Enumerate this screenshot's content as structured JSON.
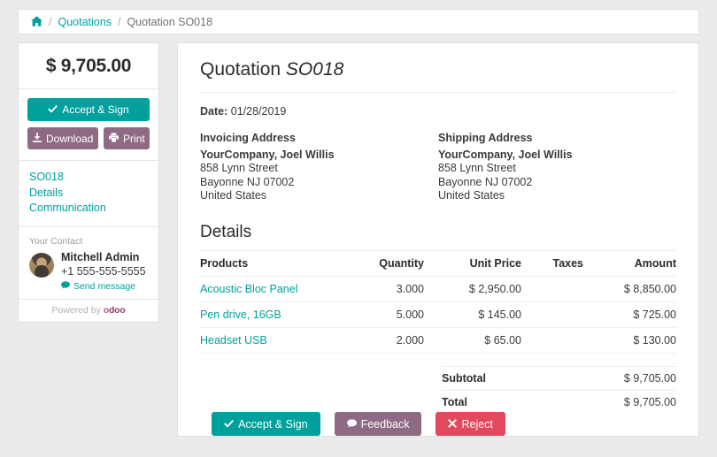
{
  "breadcrumb": {
    "home_icon": "home-icon",
    "separator": "/",
    "items": [
      {
        "label": "Quotations",
        "link": true
      },
      {
        "label": "Quotation SO018",
        "link": false
      }
    ]
  },
  "sidebar": {
    "amount": "$ 9,705.00",
    "accept_label": "Accept & Sign",
    "accept_icon": "check-icon",
    "download_label": "Download",
    "download_icon": "download-icon",
    "print_label": "Print",
    "print_icon": "printer-icon",
    "nav": [
      {
        "label": "SO018"
      },
      {
        "label": "Details"
      },
      {
        "label": "Communication"
      }
    ],
    "contact": {
      "title": "Your Contact",
      "name": "Mitchell Admin",
      "phone": "+1 555-555-5555",
      "send_message_label": "Send message",
      "send_message_icon": "comment-icon"
    },
    "powered_by": "Powered by",
    "brand": "odoo"
  },
  "main": {
    "title_prefix": "Quotation",
    "title_ref": "SO018",
    "date_label": "Date:",
    "date_value": "01/28/2019",
    "invoicing": {
      "label": "Invoicing Address",
      "company": "YourCompany, Joel Willis",
      "street": "858 Lynn Street",
      "city": "Bayonne NJ 07002",
      "country": "United States"
    },
    "shipping": {
      "label": "Shipping Address",
      "company": "YourCompany, Joel Willis",
      "street": "858 Lynn Street",
      "city": "Bayonne NJ 07002",
      "country": "United States"
    },
    "details_heading": "Details",
    "table": {
      "headers": {
        "products": "Products",
        "quantity": "Quantity",
        "unit_price": "Unit Price",
        "taxes": "Taxes",
        "amount": "Amount"
      },
      "rows": [
        {
          "product": "Acoustic Bloc Panel",
          "quantity": "3.000",
          "unit_price": "$ 2,950.00",
          "taxes": "",
          "amount": "$ 8,850.00"
        },
        {
          "product": "Pen drive, 16GB",
          "quantity": "5.000",
          "unit_price": "$ 145.00",
          "taxes": "",
          "amount": "$ 725.00"
        },
        {
          "product": "Headset USB",
          "quantity": "2.000",
          "unit_price": "$ 65.00",
          "taxes": "",
          "amount": "$ 130.00"
        }
      ]
    },
    "totals": [
      {
        "label": "Subtotal",
        "value": "$ 9,705.00"
      },
      {
        "label": "Total",
        "value": "$ 9,705.00"
      }
    ]
  },
  "footer": {
    "accept_label": "Accept & Sign",
    "accept_icon": "check-icon",
    "feedback_label": "Feedback",
    "feedback_icon": "comment-icon",
    "reject_label": "Reject",
    "reject_icon": "times-icon"
  },
  "colors": {
    "teal": "#00a09d",
    "purple": "#8f6a84",
    "red": "#e4485d",
    "page_bg": "#ebebeb"
  }
}
